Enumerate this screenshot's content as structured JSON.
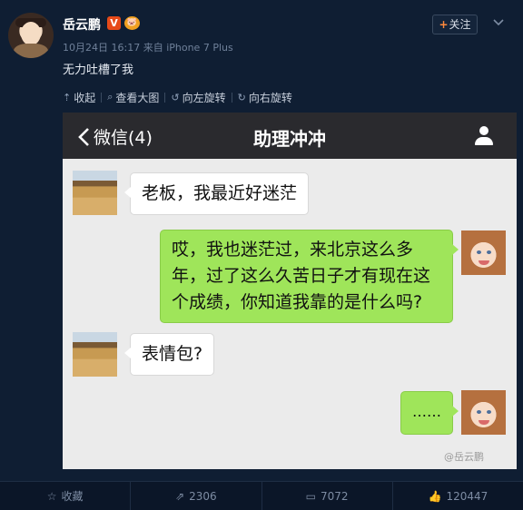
{
  "post": {
    "username": "岳云鹏",
    "verified_badge": "V",
    "level_badge": "🐷",
    "timestamp": "10月24日 16:17",
    "source": "来自 iPhone 7 Plus",
    "text": "无力吐槽了我",
    "follow_label": "关注",
    "follow_plus": "+",
    "more_icon": "chevron-down-icon"
  },
  "media_bar": {
    "collapse": "收起",
    "view_large": "查看大图",
    "rotate_left": "向左旋转",
    "rotate_right": "向右旋转"
  },
  "chat": {
    "back_label": "微信(4)",
    "title": "助理冲冲",
    "messages": [
      {
        "side": "in",
        "text": "老板，我最近好迷茫"
      },
      {
        "side": "out",
        "text": "哎，我也迷茫过，来北京这么多年，过了这么久苦日子才有现在这个成绩，你知道我靠的是什么吗?"
      },
      {
        "side": "in",
        "text": "表情包?"
      },
      {
        "side": "out",
        "text": "……"
      }
    ],
    "watermark": "@岳云鹏"
  },
  "actions": {
    "favorite": "收藏",
    "repost_count": "2306",
    "comment_count": "7072",
    "like_count": "120447"
  },
  "colors": {
    "page_bg": "#0f1e33",
    "wechat_green": "#9fe55a",
    "wechat_bar": "#2a2a2e",
    "accent_orange": "#ff8a3c"
  }
}
